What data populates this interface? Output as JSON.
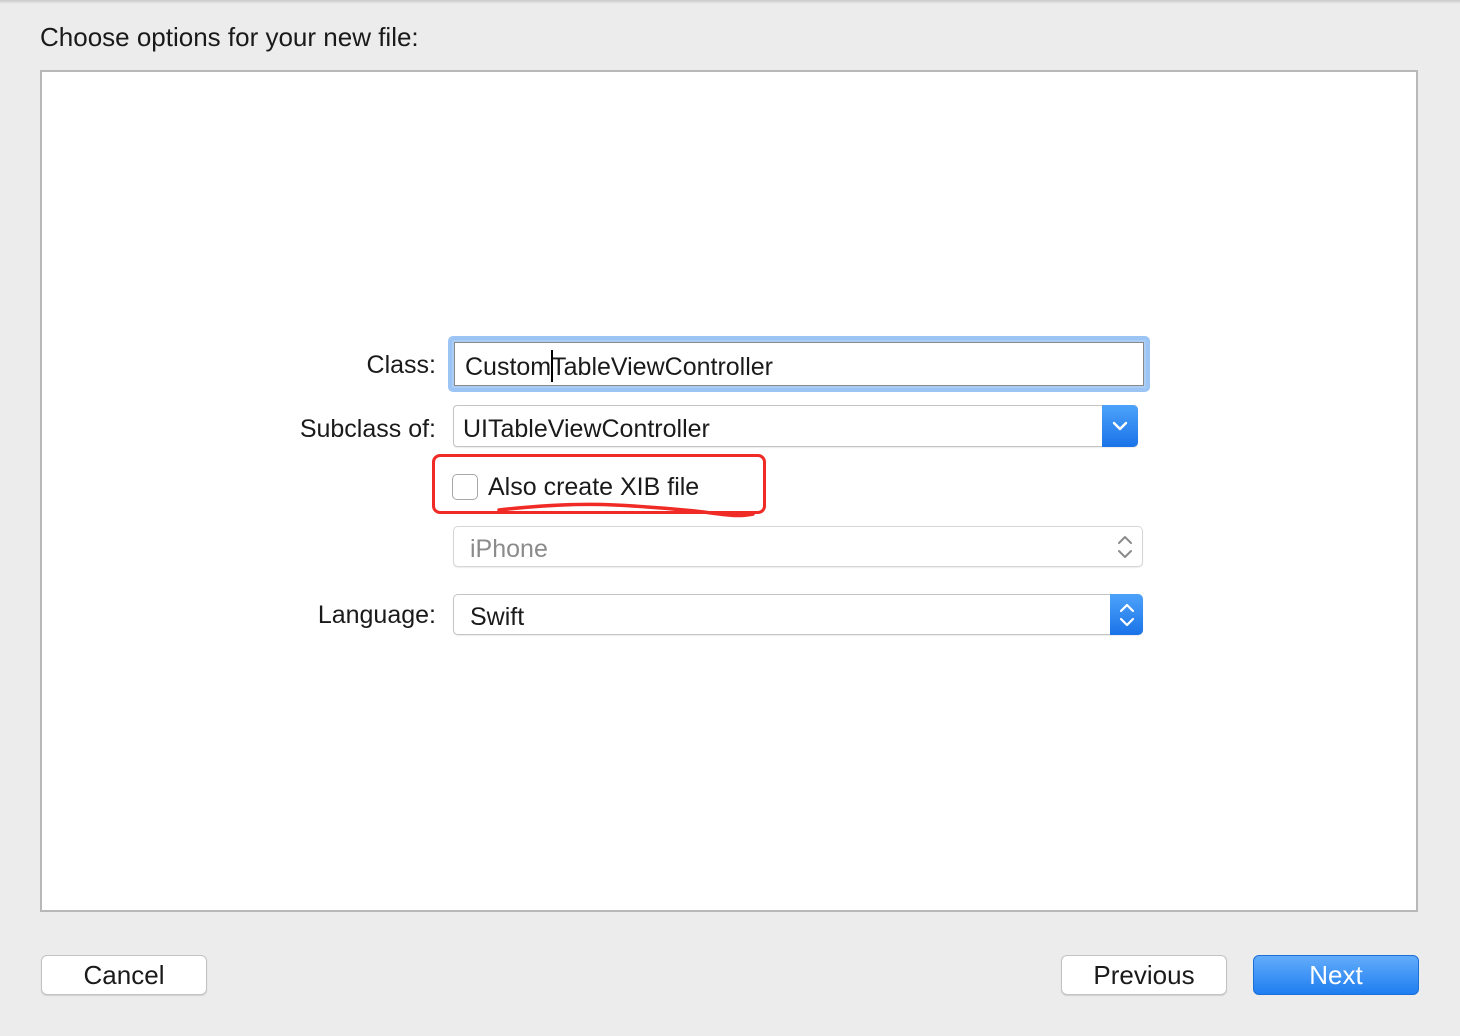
{
  "dialog": {
    "title": "Choose options for your new file:"
  },
  "form": {
    "class_label": "Class:",
    "class_value": "CustomTableViewController",
    "subclass_label": "Subclass of:",
    "subclass_value": "UITableViewController",
    "xib_label": "Also create XIB file",
    "xib_checked": false,
    "device_value": "iPhone",
    "language_label": "Language:",
    "language_value": "Swift"
  },
  "buttons": {
    "cancel": "Cancel",
    "previous": "Previous",
    "next": "Next"
  },
  "colors": {
    "accent": "#1f7ef0",
    "annotation": "#f02a24",
    "focus_ring": "#9cc5f5"
  },
  "icons": {
    "subclass_dropdown": "chevron-down-icon",
    "device_stepper": "updown-chevron-icon",
    "language_stepper": "updown-chevron-icon"
  }
}
